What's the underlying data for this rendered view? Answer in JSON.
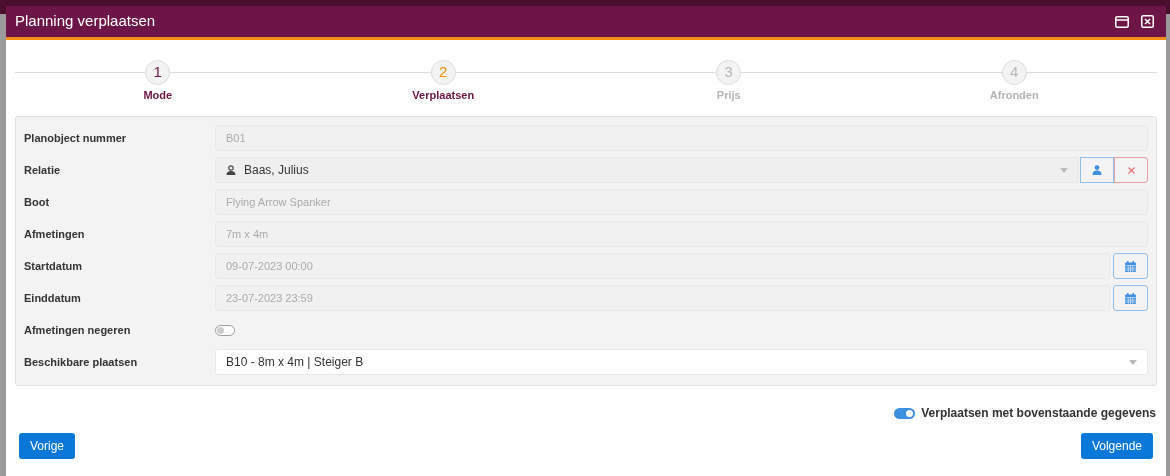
{
  "dialog": {
    "title": "Planning verplaatsen"
  },
  "steps": [
    {
      "number": "1",
      "label": "Mode",
      "completed": true,
      "selected": false
    },
    {
      "number": "2",
      "label": "Verplaatsen",
      "completed": false,
      "selected": true
    },
    {
      "number": "3",
      "label": "Prijs",
      "completed": false,
      "selected": false
    },
    {
      "number": "4",
      "label": "Afronden",
      "completed": false,
      "selected": false
    }
  ],
  "form": [
    {
      "kind": "text",
      "label": "Planobject nummer",
      "value": "B01",
      "disabled": true
    },
    {
      "kind": "relation",
      "label": "Relatie",
      "value": "Baas, Julius"
    },
    {
      "kind": "text",
      "label": "Boot",
      "value": "Flying Arrow Spanker",
      "disabled": true
    },
    {
      "kind": "text",
      "label": "Afmetingen",
      "value": "7m x 4m",
      "disabled": true
    },
    {
      "kind": "date",
      "label": "Startdatum",
      "value": "09-07-2023 00:00",
      "disabled": true
    },
    {
      "kind": "date",
      "label": "Einddatum",
      "value": "23-07-2023 23:59",
      "disabled": true
    },
    {
      "kind": "toggle",
      "label": "Afmetingen negeren",
      "on": false
    },
    {
      "kind": "select",
      "label": "Beschikbare plaatsen",
      "value": "B10 - 8m x 4m | Steiger B"
    }
  ],
  "confirm_toggle": {
    "label": "Verplaatsen met bovenstaande gegevens",
    "on": true
  },
  "buttons": {
    "back": "Vorige",
    "next": "Volgende"
  }
}
